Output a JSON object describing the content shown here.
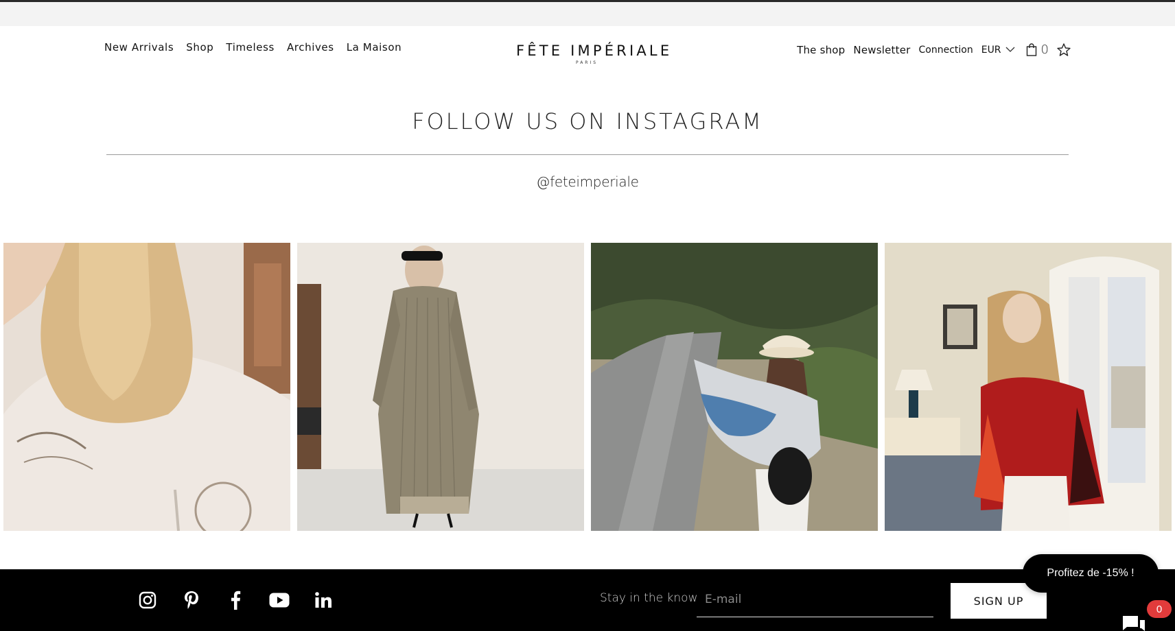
{
  "header": {
    "nav_left": [
      {
        "label": "New Arrivals"
      },
      {
        "label": "Shop"
      },
      {
        "label": "Timeless"
      },
      {
        "label": "Archives"
      },
      {
        "label": "La Maison"
      }
    ],
    "logo": {
      "brand": "FÊTE IMPÉRIALE",
      "city": "PARIS"
    },
    "nav_right": {
      "shop": "The shop",
      "newsletter": "Newsletter",
      "connection": "Connection",
      "currency": "EUR",
      "cart_count": "0"
    },
    "icons": {
      "cart": "shopping-bag-icon",
      "wishlist": "star-icon",
      "currency_dropdown": "chevron-down-icon"
    }
  },
  "instagram": {
    "title": "FOLLOW US ON INSTAGRAM",
    "handle": "@feteimperiale",
    "posts": [
      {
        "icon": "photo-blonde-woman-back-embroidered-blouse"
      },
      {
        "icon": "photo-woman-quilted-long-coat"
      },
      {
        "icon": "photo-woman-cowboy-hat-road"
      },
      {
        "icon": "photo-woman-red-blouse-interior"
      }
    ]
  },
  "footer": {
    "social": [
      "instagram-icon",
      "pinterest-icon",
      "facebook-icon",
      "youtube-icon",
      "linkedin-icon"
    ],
    "stay_label": "Stay in the know",
    "email_placeholder": "E-mail",
    "signup_label": "SIGN UP"
  },
  "promo": {
    "label": "Profitez de -15% !"
  },
  "chat": {
    "badge": "0",
    "icon": "chat-icon"
  },
  "colors": {
    "footer_bg": "#000000",
    "badge": "#e23b3b",
    "announce_bg": "#f3f3f3"
  }
}
